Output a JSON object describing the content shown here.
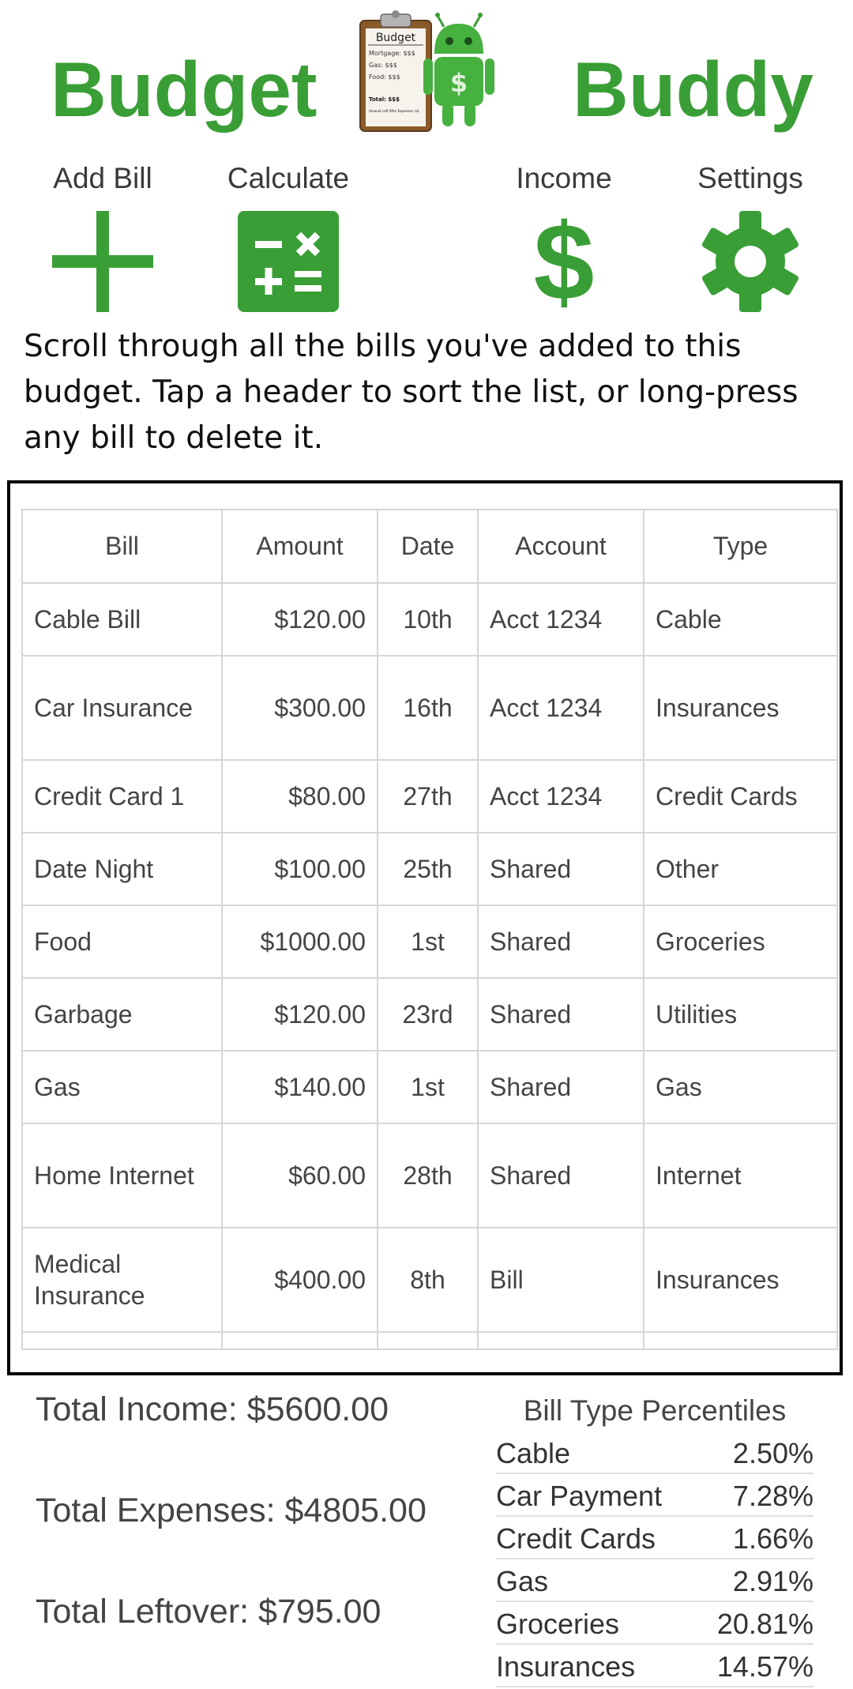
{
  "header": {
    "brand_left": "Budget",
    "brand_right": "Buddy"
  },
  "logo": {
    "title": "Budget",
    "lines": [
      "Mortgage: $$$",
      "Gas:          $$$",
      "Food:       $$$"
    ],
    "total": "Total: $$$",
    "note": "Amount Left After Expenses: $$",
    "robot_symbol": "$"
  },
  "actions": [
    {
      "label": "Add Bill",
      "icon": "plus-icon"
    },
    {
      "label": "Calculate",
      "icon": "calculator-icon"
    },
    {
      "label": "Income",
      "icon": "dollar-icon"
    },
    {
      "label": "Settings",
      "icon": "gear-icon"
    }
  ],
  "intro": "Scroll through all the bills you've added to this budget. Tap a header to sort the list, or long-press any bill to delete it.",
  "table": {
    "headers": [
      "Bill",
      "Amount",
      "Date",
      "Account",
      "Type"
    ],
    "rows": [
      {
        "bill": "Cable Bill",
        "amount": "$120.00",
        "date": "10th",
        "account": "Acct 1234",
        "type": "Cable"
      },
      {
        "bill": "Car Insurance",
        "amount": "$300.00",
        "date": "16th",
        "account": "Acct 1234",
        "type": "Insurances"
      },
      {
        "bill": "Credit Card 1",
        "amount": "$80.00",
        "date": "27th",
        "account": "Acct 1234",
        "type": "Credit Cards"
      },
      {
        "bill": "Date Night",
        "amount": "$100.00",
        "date": "25th",
        "account": "Shared",
        "type": "Other"
      },
      {
        "bill": "Food",
        "amount": "$1000.00",
        "date": "1st",
        "account": "Shared",
        "type": "Groceries"
      },
      {
        "bill": "Garbage",
        "amount": "$120.00",
        "date": "23rd",
        "account": "Shared",
        "type": "Utilities"
      },
      {
        "bill": "Gas",
        "amount": "$140.00",
        "date": "1st",
        "account": "Shared",
        "type": "Gas"
      },
      {
        "bill": "Home Internet",
        "amount": "$60.00",
        "date": "28th",
        "account": "Shared",
        "type": "Internet"
      },
      {
        "bill": "Medical Insurance",
        "amount": "$400.00",
        "date": "8th",
        "account": "Bill",
        "type": "Insurances"
      }
    ]
  },
  "totals": {
    "income": "Total Income: $5600.00",
    "expenses": "Total Expenses: $4805.00",
    "leftover": "Total Leftover: $795.00"
  },
  "percentiles": {
    "title": "Bill Type Percentiles",
    "rows": [
      {
        "type": "Cable",
        "pct": "2.50%"
      },
      {
        "type": "Car Payment",
        "pct": "7.28%"
      },
      {
        "type": "Credit Cards",
        "pct": "1.66%"
      },
      {
        "type": "Gas",
        "pct": "2.91%"
      },
      {
        "type": "Groceries",
        "pct": "20.81%"
      },
      {
        "type": "Insurances",
        "pct": "14.57%"
      }
    ]
  },
  "colors": {
    "brand_green": "#3a9e36",
    "text": "#444444",
    "border": "#d6d6d6"
  }
}
